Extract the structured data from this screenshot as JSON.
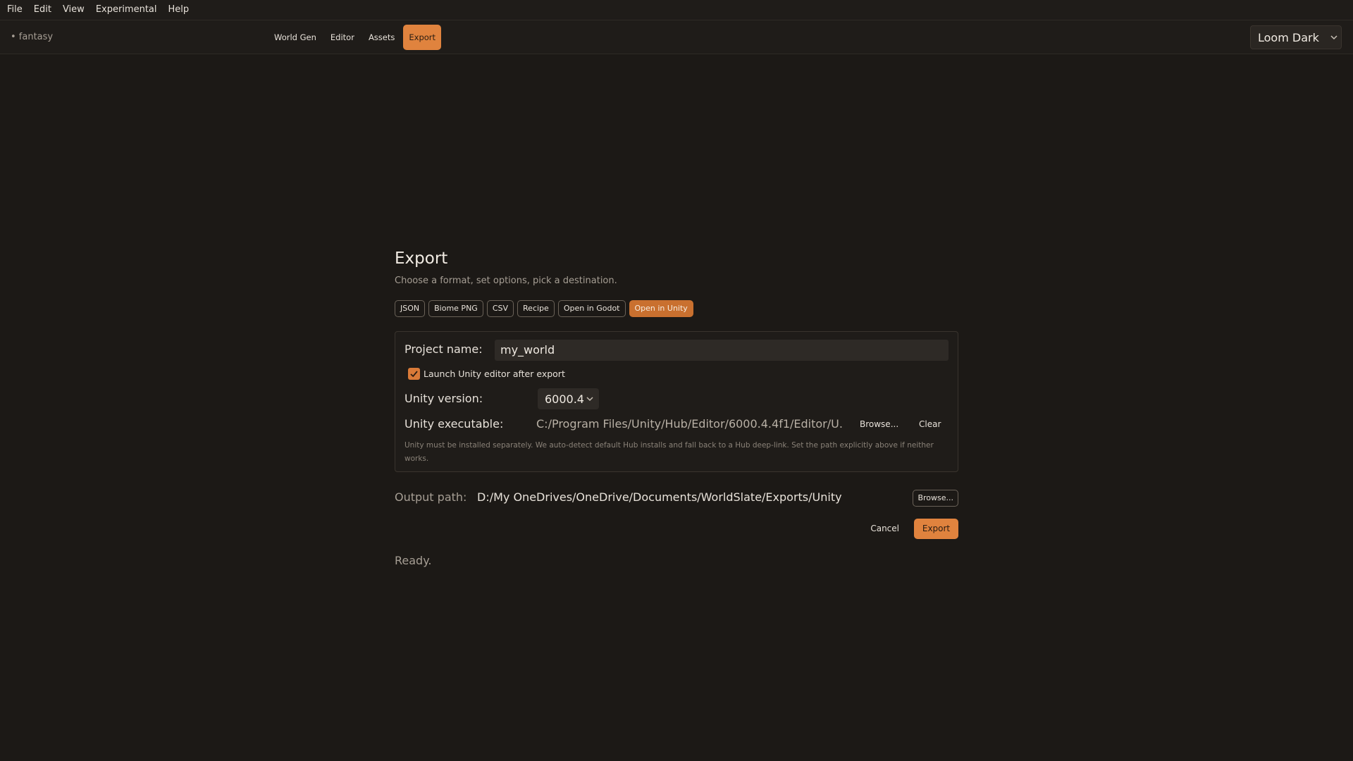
{
  "menubar": {
    "items": [
      "File",
      "Edit",
      "View",
      "Experimental",
      "Help"
    ]
  },
  "toolbar": {
    "project": "• fantasy",
    "tabs": [
      "World Gen",
      "Editor",
      "Assets",
      "Export"
    ],
    "active_tab": "Export",
    "theme": "Loom Dark"
  },
  "export": {
    "title": "Export",
    "subtitle": "Choose a format, set options, pick a destination.",
    "formats": [
      "JSON",
      "Biome PNG",
      "CSV",
      "Recipe",
      "Open in Godot",
      "Open in Unity"
    ],
    "active_format": "Open in Unity",
    "project_name_label": "Project name:",
    "project_name_value": "my_world",
    "launch_label": "Launch Unity editor after export",
    "launch_checked": true,
    "version_label": "Unity version:",
    "version_value": "6000.4",
    "exe_label": "Unity executable:",
    "exe_path": "C:/Program Files/Unity/Hub/Editor/6000.4.4f1/Editor/U...",
    "browse_label": "Browse...",
    "clear_label": "Clear",
    "hint": "Unity must be installed separately. We auto-detect default Hub installs and fall back to a Hub deep-link. Set the path explicitly above if neither works.",
    "output_label": "Output path:",
    "output_path": "D:/My OneDrives/OneDrive/Documents/WorldSlate/Exports/Unity",
    "output_browse_label": "Browse...",
    "cancel_label": "Cancel",
    "export_label": "Export",
    "status": "Ready."
  },
  "colors": {
    "background": "#1c1916",
    "accent": "#e0833e",
    "accent_dark": "#c9702f"
  }
}
